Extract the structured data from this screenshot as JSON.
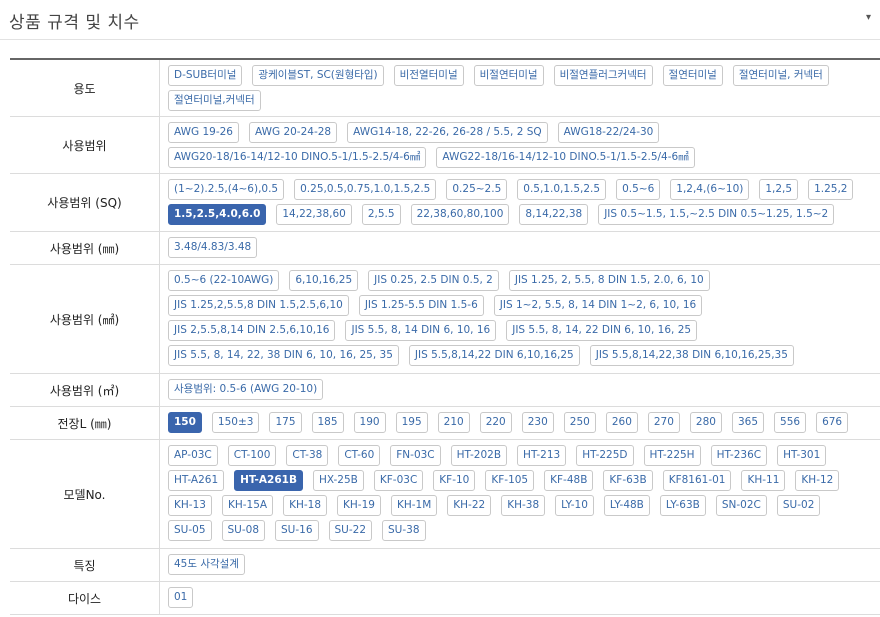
{
  "header": {
    "title": "상품 규격 및 치수",
    "chevron": "▾"
  },
  "rows": [
    {
      "label": "용도",
      "height": 57,
      "options": [
        "D-SUB터미널",
        "광케이블ST, SC(원형타입)",
        "비전열터미널",
        "비절연터미널",
        "비절연플러그커넥터",
        "절연터미널",
        "절연터미널, 커넥터",
        "절연터미널,커넥터"
      ],
      "active": []
    },
    {
      "label": "사용범위",
      "height": 57,
      "options": [
        "AWG 19-26",
        "AWG 20-24-28",
        "AWG14-18, 22-26, 26-28 / 5.5, 2 SQ",
        "AWG18-22/24-30",
        "AWG20-18/16-14/12-10 DINO.5-1/1.5-2.5/4-6㎟",
        "AWG22-18/16-14/12-10 DINO.5-1/1.5-2.5/4-6㎟"
      ],
      "active": []
    },
    {
      "label": "사용범위 (SQ)",
      "height": 58,
      "options": [
        "(1~2).2.5,(4~6),0.5",
        "0.25,0.5,0.75,1.0,1.5,2.5",
        "0.25~2.5",
        "0.5,1.0,1.5,2.5",
        "0.5~6",
        "1,2,4,(6~10)",
        "1,2,5",
        "1.25,2",
        "1.5,2.5,4.0,6.0",
        "14,22,38,60",
        "2,5.5",
        "22,38,60,80,100",
        "8,14,22,38",
        "JIS 0.5~1.5, 1.5,~2.5 DIN 0.5~1.25, 1.5~2"
      ],
      "active": [
        "1.5,2.5,4.0,6.0"
      ]
    },
    {
      "label": "사용범위 (㎜)",
      "height": 33,
      "options": [
        "3.48/4.83/3.48"
      ],
      "active": []
    },
    {
      "label": "사용범위 (㎟)",
      "height": 109,
      "options": [
        "0.5~6 (22-10AWG)",
        "6,10,16,25",
        "JIS 0.25, 2.5 DIN 0.5, 2",
        "JIS 1.25, 2, 5.5, 8 DIN 1.5, 2.0, 6, 10",
        "JIS 1.25,2,5.5,8 DIN 1.5,2.5,6,10",
        "JIS 1.25-5.5 DIN 1.5-6",
        "JIS 1~2, 5.5, 8, 14 DIN 1~2, 6, 10, 16",
        "JIS 2,5.5,8,14 DIN 2.5,6,10,16",
        "JIS 5.5, 8, 14 DIN 6, 10, 16",
        "JIS 5.5, 8, 14, 22 DIN 6, 10, 16, 25",
        "JIS 5.5, 8, 14, 22, 38 DIN 6, 10, 16, 25, 35",
        "JIS 5.5,8,14,22 DIN 6,10,16,25",
        "JIS 5.5,8,14,22,38 DIN 6,10,16,25,35"
      ],
      "active": []
    },
    {
      "label": "사용범위 (㎡)",
      "height": 33,
      "options": [
        "사용범위: 0.5-6 (AWG 20-10)"
      ],
      "active": []
    },
    {
      "label": "전장L (㎜)",
      "height": 33,
      "options": [
        "150",
        "150±3",
        "175",
        "185",
        "190",
        "195",
        "210",
        "220",
        "230",
        "250",
        "260",
        "270",
        "280",
        "365",
        "556",
        "676"
      ],
      "active": [
        "150"
      ]
    },
    {
      "label": "모델No.",
      "height": 109,
      "options": [
        "AP-03C",
        "CT-100",
        "CT-38",
        "CT-60",
        "FN-03C",
        "HT-202B",
        "HT-213",
        "HT-225D",
        "HT-225H",
        "HT-236C",
        "HT-301",
        "HT-A261",
        "HT-A261B",
        "HX-25B",
        "KF-03C",
        "KF-10",
        "KF-105",
        "KF-48B",
        "KF-63B",
        "KF8161-01",
        "KH-11",
        "KH-12",
        "KH-13",
        "KH-15A",
        "KH-18",
        "KH-19",
        "KH-1M",
        "KH-22",
        "KH-38",
        "LY-10",
        "LY-48B",
        "LY-63B",
        "SN-02C",
        "SU-02",
        "SU-05",
        "SU-08",
        "SU-16",
        "SU-22",
        "SU-38"
      ],
      "active": [
        "HT-A261B"
      ]
    },
    {
      "label": "특징",
      "height": 33,
      "options": [
        "45도 사각설계"
      ],
      "active": []
    },
    {
      "label": "다이스",
      "height": 33,
      "options": [
        "01"
      ],
      "active": []
    }
  ]
}
